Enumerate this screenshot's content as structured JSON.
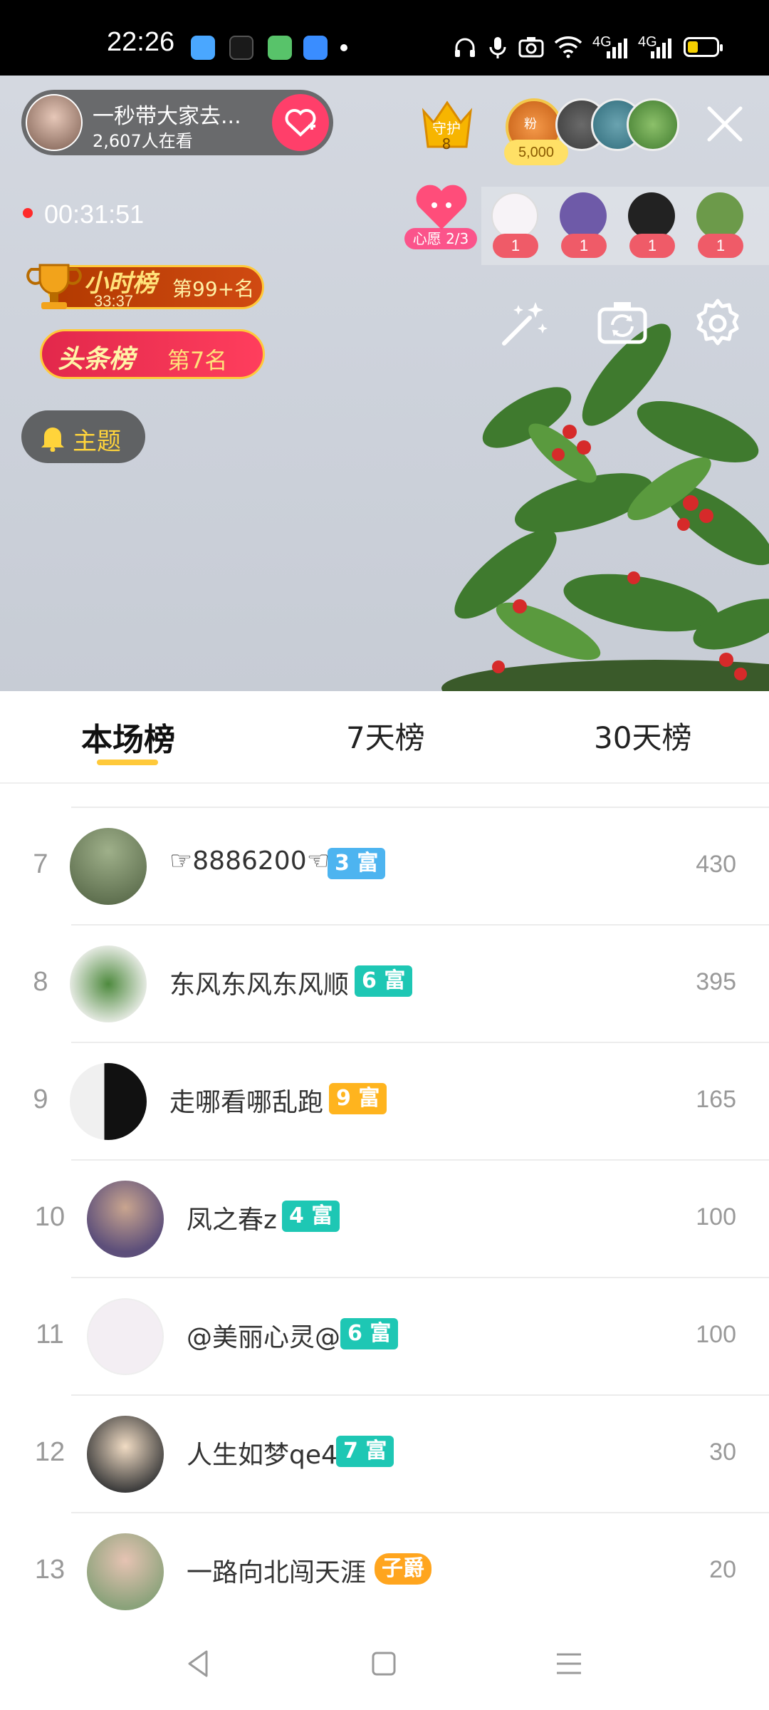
{
  "status_bar": {
    "time": "22:26",
    "network_1": "4G",
    "network_2": "4G"
  },
  "live": {
    "host_name": "一秒带大家去...",
    "viewers": "2,607人在看",
    "guard_label": "守护",
    "guard_count": "8",
    "fan_label": "粉",
    "fan_count": "5,000",
    "timer": "00:31:51",
    "wish_label": "心愿 2/3",
    "gifters": [
      {
        "count": "1",
        "color": "#f7f3f7"
      },
      {
        "count": "1",
        "color": "#6e5aa8"
      },
      {
        "count": "1",
        "color": "#222222"
      },
      {
        "count": "1",
        "color": "#6c9a4a"
      }
    ],
    "hour_rank_title": "小时榜",
    "hour_rank_time": "33:37",
    "hour_rank_position": "第99+名",
    "headline_rank_title": "头条榜",
    "headline_rank_position": "第7名",
    "topic_label": "主题",
    "icons": [
      "magic-wand-icon",
      "camera-flip-icon",
      "settings-gear-icon",
      "close-icon"
    ]
  },
  "leaderboard": {
    "tabs": [
      {
        "label": "本场榜",
        "active": true
      },
      {
        "label": "7天榜",
        "active": false
      },
      {
        "label": "30天榜",
        "active": false
      }
    ],
    "rows": [
      {
        "rank": "7",
        "name": "☞8886200☜",
        "level": "3 富",
        "level_color": "#4db4f0",
        "score": "430",
        "avatar_color": "#6b7d5b"
      },
      {
        "rank": "8",
        "name": "东风东风东风顺",
        "level": "6 富",
        "level_color": "#1ec7b4",
        "score": "395",
        "avatar_color": "#3f6b3a"
      },
      {
        "rank": "9",
        "name": "走哪看哪乱跑",
        "level": "9 富",
        "level_color": "#ffb41e",
        "score": "165",
        "avatar_color": "#1b1b1b"
      },
      {
        "rank": "10",
        "name": "凤之春z",
        "level": "4 富",
        "level_color": "#1ec7b4",
        "score": "100",
        "avatar_color": "#8a7ab3"
      },
      {
        "rank": "11",
        "name": "@美丽心灵@",
        "level": "6 富",
        "level_color": "#1ec7b4",
        "score": "100",
        "avatar_color": "#f3eef3"
      },
      {
        "rank": "12",
        "name": "人生如梦qe4",
        "level": "7 富",
        "level_color": "#1ec7b4",
        "score": "30",
        "avatar_color": "#c9b59a"
      },
      {
        "rank": "13",
        "name": "一路向北闯天涯",
        "level": "子爵",
        "level_color": "#ffa51e",
        "score": "20",
        "avatar_color": "#b7a28e"
      }
    ]
  },
  "nav": [
    "back-icon",
    "home-icon",
    "menu-icon"
  ]
}
